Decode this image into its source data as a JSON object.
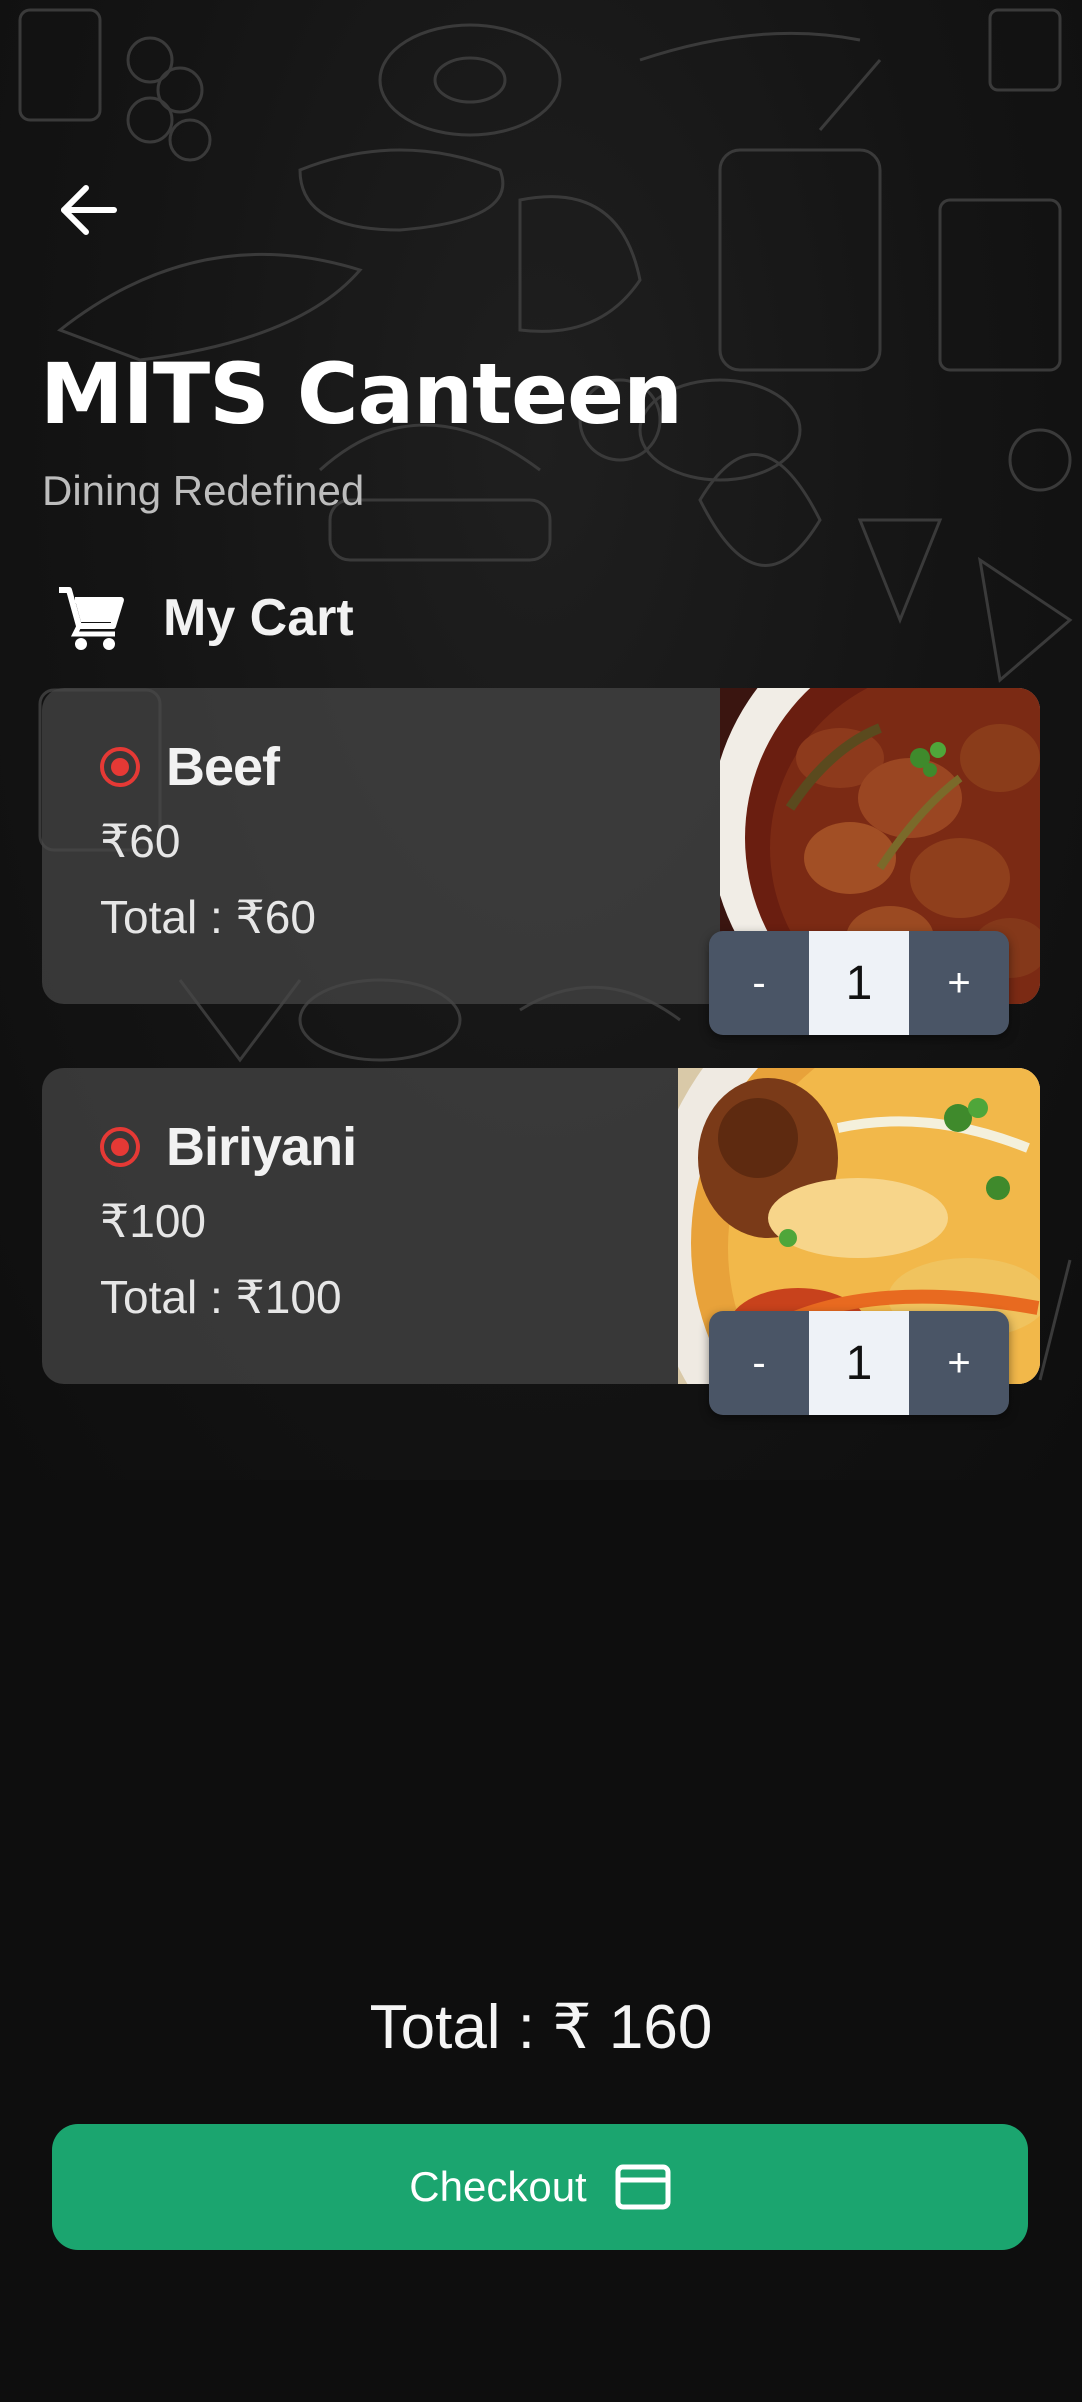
{
  "header": {
    "back_icon": "arrow-left-icon",
    "title": "MITS Canteen",
    "subtitle": "Dining Redefined"
  },
  "cart": {
    "icon": "shopping-cart-icon",
    "title": "My Cart",
    "items": [
      {
        "name": "Beef",
        "price": "₹60",
        "total": "Total : ₹60",
        "quantity": "1",
        "minus_label": "-",
        "plus_label": "+",
        "marker_color": "#e53935"
      },
      {
        "name": "Biriyani",
        "price": "₹100",
        "total": "Total : ₹100",
        "quantity": "1",
        "minus_label": "-",
        "plus_label": "+",
        "marker_color": "#e53935"
      }
    ]
  },
  "footer": {
    "total": "Total : ₹ 160",
    "checkout_label": "Checkout",
    "checkout_icon": "credit-card-icon",
    "checkout_color": "#1ba56f"
  }
}
